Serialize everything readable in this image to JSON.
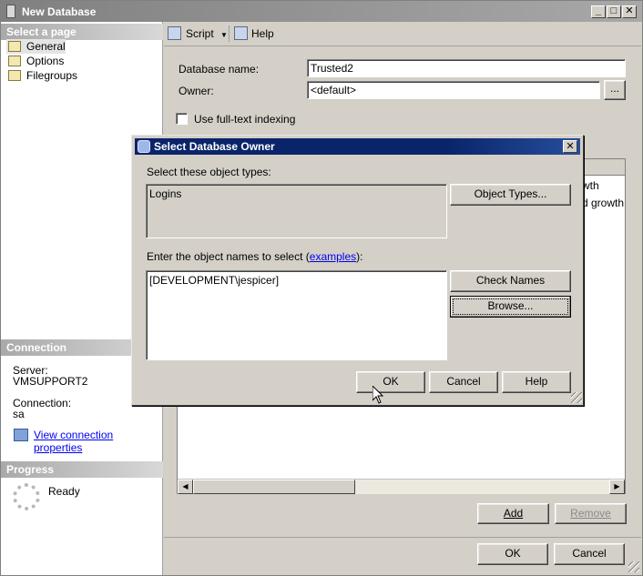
{
  "window": {
    "title": "New Database"
  },
  "left": {
    "select_page_title": "Select a page",
    "pages": [
      {
        "label": "General",
        "selected": true
      },
      {
        "label": "Options",
        "selected": false
      },
      {
        "label": "Filegroups",
        "selected": false
      }
    ],
    "connection": {
      "title": "Connection",
      "server_label": "Server:",
      "server_value": "VMSUPPORT2",
      "connection_label": "Connection:",
      "connection_value": "sa",
      "link": "View connection properties"
    },
    "progress": {
      "title": "Progress",
      "status": "Ready"
    }
  },
  "toolbar": {
    "script": "Script",
    "help": "Help"
  },
  "form": {
    "db_name_label": "Database name:",
    "db_name_value": "Trusted2",
    "owner_label": "Owner:",
    "owner_value": "<default>",
    "browse_label": "...",
    "fulltext_label": "Use full-text indexing"
  },
  "grid_fragments": {
    "row1": "wth",
    "row2": "d growth"
  },
  "bottom": {
    "add": "Add",
    "remove": "Remove",
    "ok": "OK",
    "cancel": "Cancel"
  },
  "dialog": {
    "title": "Select Database Owner",
    "types_label": "Select these object types:",
    "types_value": "Logins",
    "object_types_button": "Object Types...",
    "names_label": "Enter the object names to select (",
    "examples_link": "examples",
    "names_label_end": "):",
    "names_value": "[DEVELOPMENT\\jespicer]",
    "check_names_button": "Check Names",
    "browse_button": "Browse...",
    "ok_button": "OK",
    "cancel_button": "Cancel",
    "help_button": "Help"
  }
}
